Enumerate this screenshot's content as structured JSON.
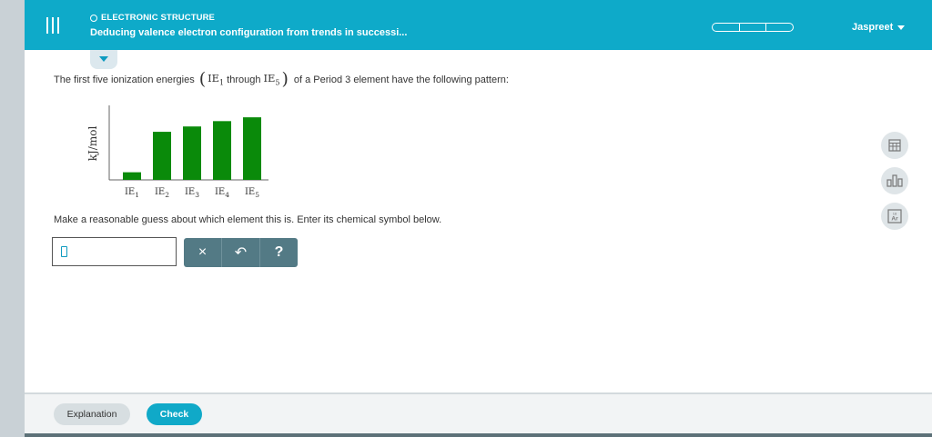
{
  "header": {
    "section": "ELECTRONIC STRUCTURE",
    "title": "Deducing valence electron configuration from trends in successi...",
    "user": "Jaspreet",
    "progress_segments": 3,
    "color": "#0eaac9"
  },
  "question": {
    "text_before": "The first five ionization energies",
    "ie_first": "IE",
    "ie_first_sub": "1",
    "through": "through",
    "ie_last": "IE",
    "ie_last_sub": "5",
    "text_after": "of a Period 3 element have the following pattern:"
  },
  "chart_data": {
    "type": "bar",
    "ylabel": "kJ/mol",
    "categories": [
      {
        "base": "IE",
        "sub": "1"
      },
      {
        "base": "IE",
        "sub": "2"
      },
      {
        "base": "IE",
        "sub": "3"
      },
      {
        "base": "IE",
        "sub": "4"
      },
      {
        "base": "IE",
        "sub": "5"
      }
    ],
    "values": [
      10,
      63,
      70,
      77,
      82
    ],
    "ylim": [
      0,
      100
    ],
    "bar_color": "#0a8a0a",
    "grid": false
  },
  "instruction": "Make a reasonable guess about which element this is. Enter its chemical symbol below.",
  "answer": {
    "value": ""
  },
  "buttons": {
    "clear": "×",
    "undo": "↶",
    "help": "?"
  },
  "tools": [
    "calculator-icon",
    "bar-chart-icon",
    "periodic-table-icon"
  ],
  "periodic_tool": {
    "number": "18",
    "symbol": "Ar"
  },
  "footer": {
    "explanation": "Explanation",
    "check": "Check"
  }
}
